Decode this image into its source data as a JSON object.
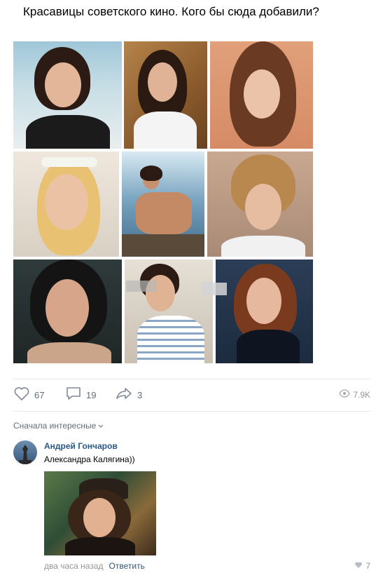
{
  "post": {
    "title": "Красавицы советского кино. Кого бы сюда добавили?",
    "photos": [
      {
        "label": "actress-1"
      },
      {
        "label": "actress-2"
      },
      {
        "label": "actress-3"
      },
      {
        "label": "actress-4"
      },
      {
        "label": "actress-5"
      },
      {
        "label": "actress-6"
      },
      {
        "label": "actress-7"
      },
      {
        "label": "actress-8"
      },
      {
        "label": "actress-9"
      }
    ]
  },
  "actions": {
    "likes": "67",
    "comments": "19",
    "shares": "3",
    "views": "7.9K",
    "like_icon": "heart-icon",
    "comment_icon": "comment-icon",
    "share_icon": "share-icon",
    "views_icon": "eye-icon"
  },
  "comments": {
    "sort_label": "Сначала интересные",
    "items": [
      {
        "author": "Андрей Гончаров",
        "text": "Александра Калягина))",
        "time": "два часа назад",
        "reply_label": "Ответить",
        "likes": "7"
      }
    ]
  },
  "colors": {
    "link": "#2a5885",
    "muted": "#939699",
    "action": "#626d7a",
    "divider": "#e7e8ec"
  }
}
